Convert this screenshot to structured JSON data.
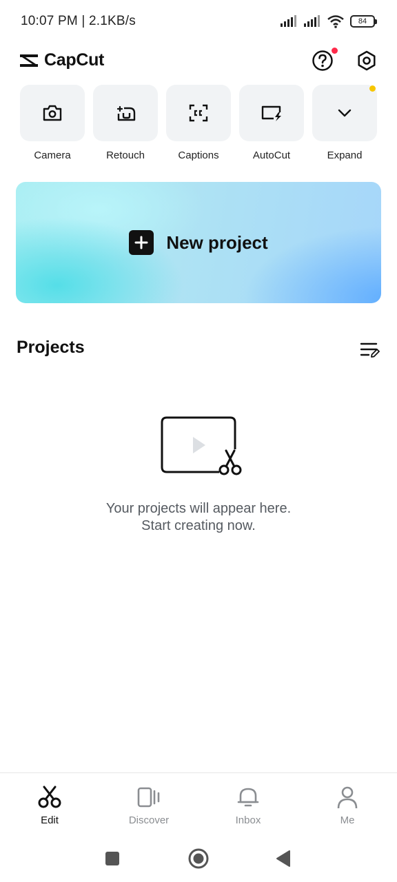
{
  "status_bar": {
    "time": "10:07 PM | 2.1KB/s",
    "battery": "84"
  },
  "header": {
    "app_name": "CapCut",
    "icons": [
      "capcut-logo-icon",
      "help-icon",
      "settings-icon"
    ]
  },
  "tools": [
    {
      "label": "Camera",
      "icon": "camera-icon"
    },
    {
      "label": "Retouch",
      "icon": "retouch-icon"
    },
    {
      "label": "Captions",
      "icon": "captions-icon"
    },
    {
      "label": "AutoCut",
      "icon": "autocut-icon"
    },
    {
      "label": "Expand",
      "icon": "chevron-down-icon"
    }
  ],
  "new_project": {
    "label": "New project"
  },
  "projects": {
    "title": "Projects",
    "empty_line1": "Your projects will appear here.",
    "empty_line2": "Start creating now."
  },
  "bottom_nav": [
    {
      "label": "Edit",
      "icon": "scissors-icon",
      "active": true
    },
    {
      "label": "Discover",
      "icon": "discover-icon",
      "active": false
    },
    {
      "label": "Inbox",
      "icon": "bell-icon",
      "active": false
    },
    {
      "label": "Me",
      "icon": "person-icon",
      "active": false
    }
  ],
  "colors": {
    "notification_dot": "#ff2a4a",
    "expand_dot": "#f7c600",
    "tool_bg": "#f1f3f5",
    "inactive_nav": "#8a8d91"
  }
}
